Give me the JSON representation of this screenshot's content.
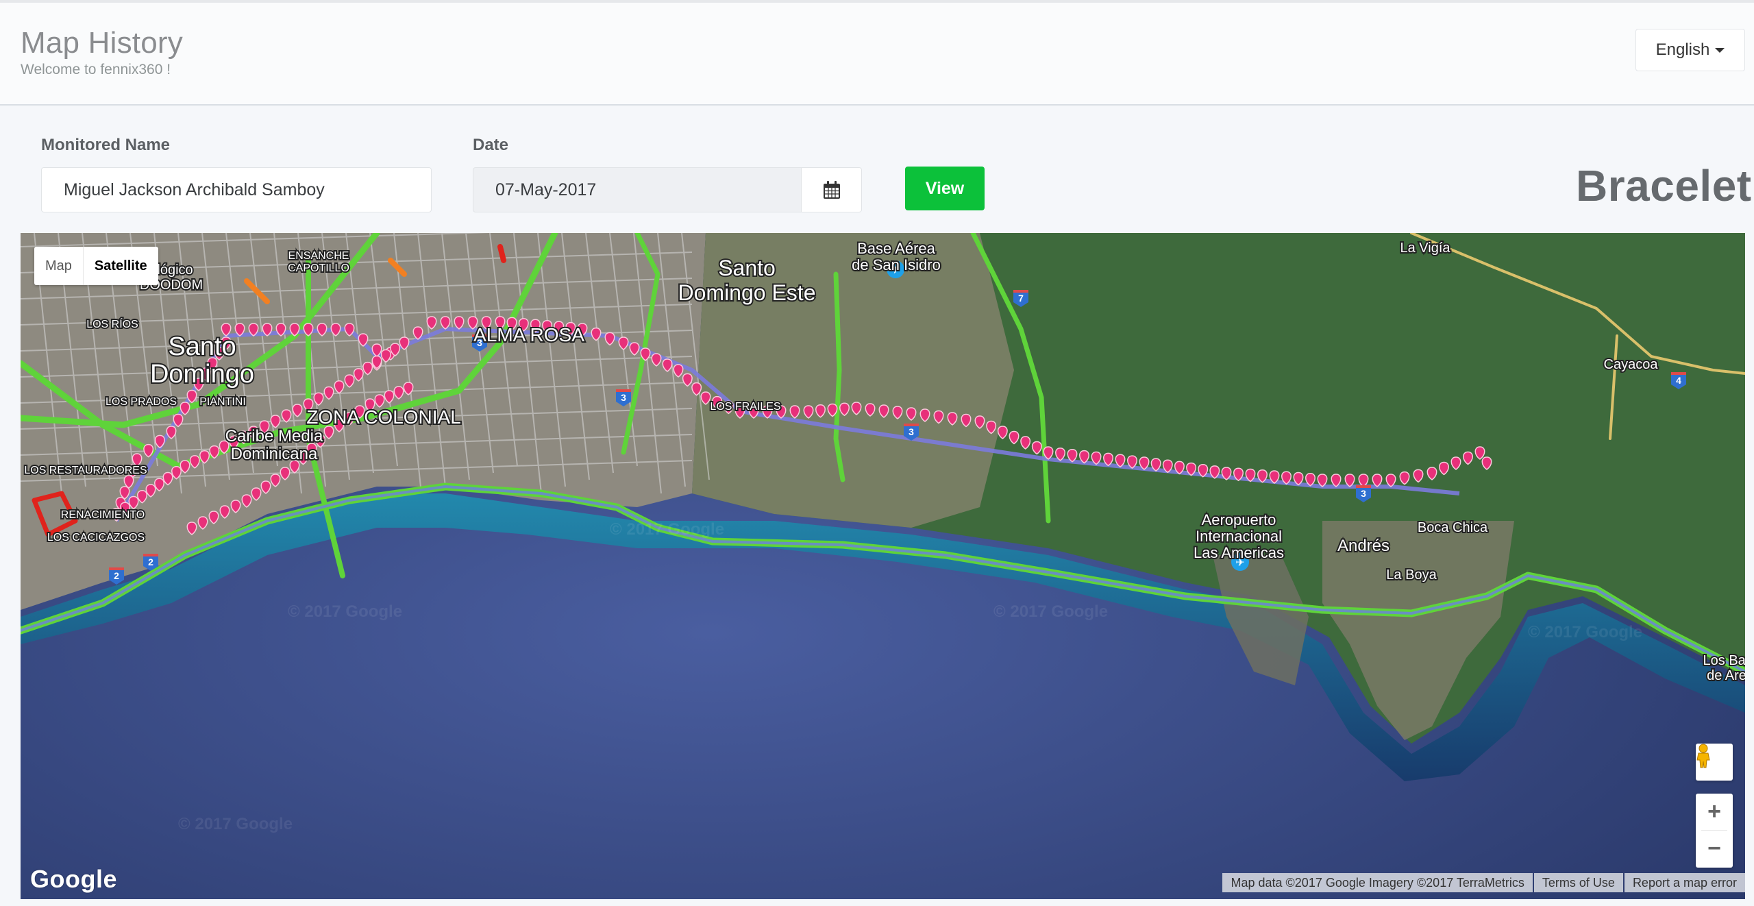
{
  "header": {
    "title": "Map History",
    "subtitle": "Welcome to fennix360 !",
    "language_selector": "English"
  },
  "form": {
    "monitored_name_label": "Monitored Name",
    "monitored_name_value": "Miguel Jackson Archibald Samboy",
    "date_label": "Date",
    "date_value": "07-May-2017",
    "calendar_icon": "calendar-icon",
    "view_button": "View",
    "device_type": "Bracelet"
  },
  "map": {
    "type_buttons": [
      {
        "label": "Map",
        "active": false
      },
      {
        "label": "Satellite",
        "active": true
      }
    ],
    "colors": {
      "route_marker": "#e8307a",
      "route_line": "#7b7bdc",
      "traffic_fast": "#5fd33a",
      "traffic_slow": "#f28022",
      "traffic_jam": "#e0231c",
      "ocean": "#2f3f72"
    },
    "place_labels": [
      {
        "text": "Santo Domingo",
        "size": "large"
      },
      {
        "text": "Santo Domingo Este",
        "size": "large"
      },
      {
        "text": "ALMA ROSA",
        "size": "district"
      },
      {
        "text": "ZONA COLONIAL",
        "size": "district"
      },
      {
        "text": "Caribe Media Dominicana",
        "size": "poi"
      },
      {
        "text": "ológico DOODOM",
        "size": "poi"
      },
      {
        "text": "ENSANCHE CAPOTILLO",
        "size": "small"
      },
      {
        "text": "LOS RÍOS",
        "size": "small"
      },
      {
        "text": "LOS PRADOS",
        "size": "small"
      },
      {
        "text": "PIANTINI",
        "size": "small"
      },
      {
        "text": "LOS RESTAURADORES",
        "size": "small"
      },
      {
        "text": "RENACIMIENTO",
        "size": "small"
      },
      {
        "text": "LOS CACICAZGOS",
        "size": "small"
      },
      {
        "text": "LOS FRAILES",
        "size": "small"
      },
      {
        "text": "Base Aérea de San Isidro",
        "size": "poi"
      },
      {
        "text": "La Vigía",
        "size": "poi"
      },
      {
        "text": "Cayacoa",
        "size": "poi"
      },
      {
        "text": "Aeropuerto Internacional Las Americas",
        "size": "poi"
      },
      {
        "text": "Andrés",
        "size": "poi"
      },
      {
        "text": "La Boya",
        "size": "poi"
      },
      {
        "text": "Boca Chica",
        "size": "poi"
      },
      {
        "text": "Los Barrancones de Arena",
        "size": "poi"
      }
    ],
    "highway_shields": [
      "2",
      "2",
      "3",
      "3",
      "3",
      "3",
      "7",
      "4"
    ],
    "watermark": "© 2017 Google",
    "logo": "Google",
    "attribution": "Map data ©2017 Google Imagery ©2017 TerraMetrics",
    "terms_link": "Terms of Use",
    "report_link": "Report a map error",
    "zoom_in": "+",
    "zoom_out": "−"
  }
}
